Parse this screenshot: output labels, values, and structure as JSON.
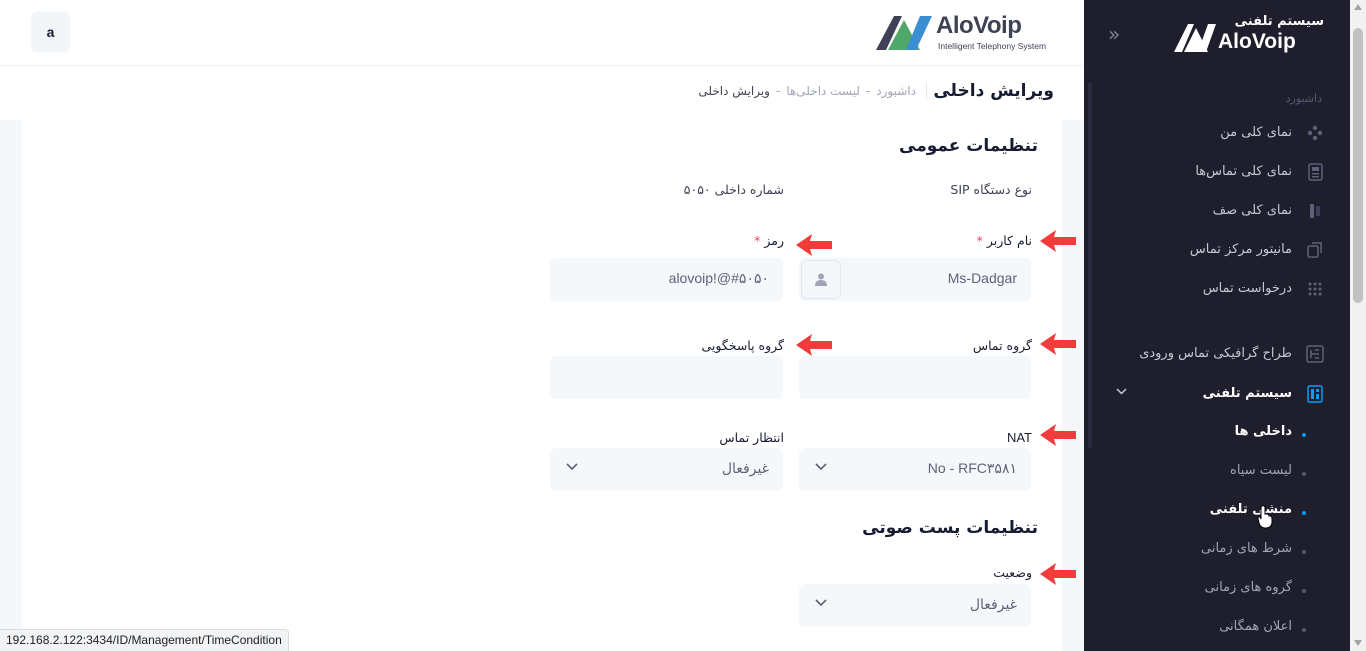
{
  "header": {
    "avatar_letter": "a",
    "logo_brand": "AloVoip",
    "logo_tagline": "Intelligent Telephony System"
  },
  "subheader": {
    "title": "ویرایش داخلی",
    "breadcrumb": [
      "داشبورد",
      "-",
      "لیست داخلی‌ها",
      "-",
      "ویرایش داخلی"
    ]
  },
  "form": {
    "general_title": "تنظیمات عمومی",
    "device_type": "نوع دستگاه SIP",
    "extension_number": "شماره داخلی ۵۰۵۰",
    "username_label": "نام کاربر",
    "username_value": "Ms-Dadgar",
    "password_label": "رمز",
    "password_value": "alovoip!@#۵۰۵۰",
    "required_mark": "*",
    "call_group_label": "گروه تماس",
    "call_group_value": "",
    "pickup_group_label": "گروه پاسخگویی",
    "pickup_group_value": "",
    "nat_label": "NAT",
    "nat_value": "No - RFC۳۵۸۱",
    "call_waiting_label": "انتظار تماس",
    "call_waiting_value": "غیرفعال",
    "voicemail_title": "تنظیمات پست صوتی",
    "status_label": "وضعیت",
    "status_value": "غیرفعال"
  },
  "sidebar": {
    "logo_title": "سیستم تلفنی",
    "logo_brand": "AloVoip",
    "section_heading": "داشبورد",
    "items": [
      {
        "label": "نمای کلی من",
        "icon": "dashboard-icon"
      },
      {
        "label": "نمای کلی تماس‌ها",
        "icon": "calls-icon"
      },
      {
        "label": "نمای کلی صف",
        "icon": "queue-icon"
      },
      {
        "label": "مانیتور مرکز تماس",
        "icon": "monitor-icon"
      },
      {
        "label": "درخواست تماس",
        "icon": "grid-icon"
      },
      {
        "label": "طراح گرافیکی تماس ورودی",
        "icon": "designer-icon"
      },
      {
        "label": "سیستم تلفنی",
        "icon": "phone-system-icon"
      }
    ],
    "subitems": [
      {
        "label": "داخلی ها",
        "active": true
      },
      {
        "label": "لیست سیاه",
        "active": false
      },
      {
        "label": "منشی تلفنی",
        "active": true
      },
      {
        "label": "شرط های زمانی",
        "active": false
      },
      {
        "label": "گروه های زمانی",
        "active": false
      },
      {
        "label": "اعلان همگانی",
        "active": false
      }
    ]
  },
  "status_bar": {
    "url": "192.168.2.122:3434/ID/Management/TimeCondition"
  },
  "colors": {
    "accent": "#009ef7",
    "sidebar_bg": "#1e1e2d",
    "arrow": "#f1416c",
    "required": "#f1416c"
  }
}
